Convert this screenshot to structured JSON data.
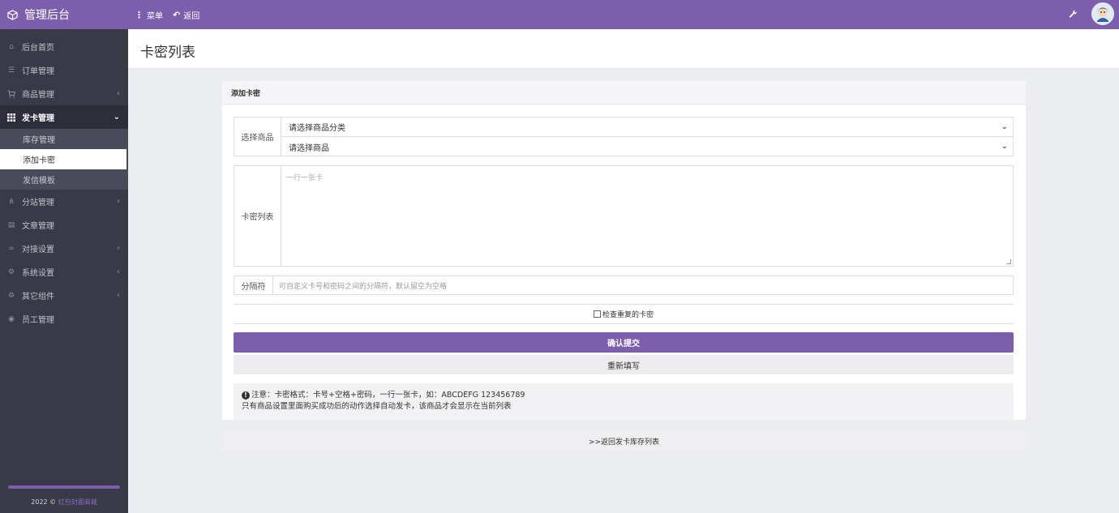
{
  "topbar": {
    "brand": "管理后台",
    "menu_label": "菜单",
    "back_label": "返回",
    "accent_color": "#7b5fad"
  },
  "sidebar": {
    "items": [
      {
        "label": "后台首页",
        "icon": "home-icon"
      },
      {
        "label": "订单管理",
        "icon": "list-icon"
      },
      {
        "label": "商品管理",
        "icon": "cart-icon",
        "has_submenu": true
      },
      {
        "label": "发卡管理",
        "icon": "grid-icon",
        "expanded": true
      },
      {
        "label": "分站管理",
        "icon": "sitemap-icon",
        "has_submenu": true
      },
      {
        "label": "文章管理",
        "icon": "article-icon"
      },
      {
        "label": "对接设置",
        "icon": "link-icon",
        "has_submenu": true
      },
      {
        "label": "系统设置",
        "icon": "gear-icon",
        "has_submenu": true
      },
      {
        "label": "其它组件",
        "icon": "cogs-icon",
        "has_submenu": true
      },
      {
        "label": "员工管理",
        "icon": "user-circle-icon"
      }
    ],
    "submenu": [
      {
        "label": "库存管理"
      },
      {
        "label": "添加卡密",
        "active": true
      },
      {
        "label": "发信模板"
      }
    ],
    "footer_year": "2022 ©",
    "footer_brand": "红包封面商城"
  },
  "page": {
    "title": "卡密列表"
  },
  "form": {
    "panel_title": "添加卡密",
    "select_label": "选择商品",
    "category_select": "请选择商品分类",
    "product_select": "请选择商品",
    "cards_label": "卡密列表",
    "cards_placeholder": "一行一张卡",
    "separator_label": "分隔符",
    "separator_placeholder": "可自定义卡号和密码之间的分隔符，默认留空为空格",
    "check_duplicates_label": "检查重复的卡密",
    "submit_label": "确认提交",
    "reset_label": "重新填写",
    "note_line1": "注意：卡密格式：卡号+空格+密码，一行一张卡，如：ABCDEFG 123456789",
    "note_line2": "只有商品设置里面购买成功后的动作选择自动发卡，该商品才会显示在当前列表"
  },
  "back_link": ">>返回发卡库存列表"
}
